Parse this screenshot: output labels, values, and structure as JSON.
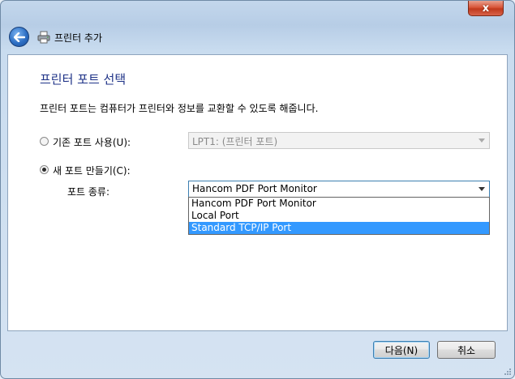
{
  "window": {
    "title": "프린터 추가",
    "close_label": "x"
  },
  "page": {
    "heading": "프린터 포트 선택",
    "description": "프린터 포트는 컴퓨터가 프린터와 정보를 교환할 수 있도록 해줍니다."
  },
  "existing_port": {
    "label": "기존 포트 사용(U):",
    "selected": false,
    "value": "LPT1: (프린터 포트)"
  },
  "new_port": {
    "label": "새 포트 만들기(C):",
    "selected": true,
    "type_label": "포트 종류:",
    "value": "Hancom PDF Port Monitor",
    "options": [
      {
        "label": "Hancom PDF Port Monitor",
        "highlighted": false
      },
      {
        "label": "Local Port",
        "highlighted": false
      },
      {
        "label": "Standard TCP/IP Port",
        "highlighted": true
      }
    ]
  },
  "buttons": {
    "next": "다음(N)",
    "cancel": "취소"
  },
  "colors": {
    "heading": "#1e3287",
    "selection": "#3399ff"
  }
}
